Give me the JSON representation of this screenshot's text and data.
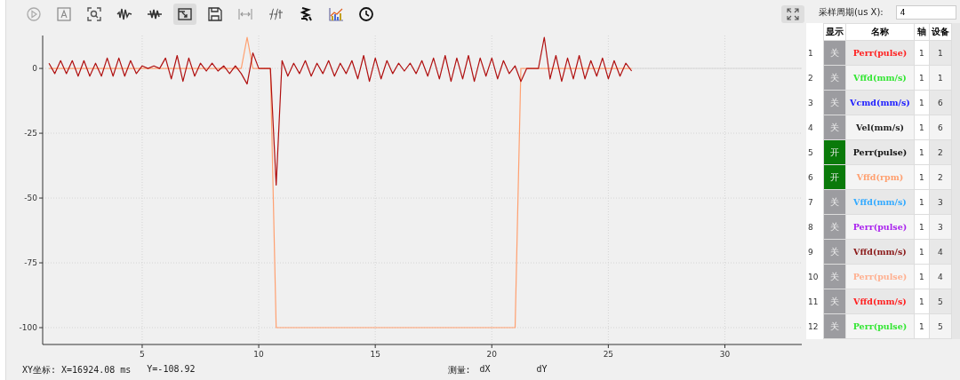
{
  "toolbar": [
    {
      "kind": "play",
      "selected": false
    },
    {
      "kind": "text",
      "selected": false
    },
    {
      "kind": "zoom",
      "selected": false
    },
    {
      "kind": "wave",
      "selected": false
    },
    {
      "kind": "filter",
      "selected": false
    },
    {
      "kind": "export",
      "selected": true
    },
    {
      "kind": "save",
      "selected": false
    },
    {
      "kind": "span",
      "selected": false
    },
    {
      "kind": "fft",
      "selected": false
    },
    {
      "kind": "stairs",
      "selected": false
    },
    {
      "kind": "chart",
      "selected": false
    },
    {
      "kind": "clock",
      "selected": false
    }
  ],
  "chart": {
    "chart_data": {
      "type": "line",
      "grid": true,
      "xlim": [
        0.73,
        33.3
      ],
      "ylim": [
        -106.5,
        12.7
      ],
      "xticks": [
        5,
        10,
        15,
        20,
        25,
        30
      ],
      "yticks": [
        0,
        -25,
        -50,
        -75,
        -100
      ],
      "x": [
        1,
        1.25,
        1.5,
        1.75,
        2,
        2.25,
        2.5,
        2.75,
        3,
        3.25,
        3.5,
        3.75,
        4,
        4.25,
        4.5,
        4.75,
        5,
        5.25,
        5.5,
        5.75,
        6,
        6.25,
        6.5,
        6.75,
        7,
        7.25,
        7.5,
        7.75,
        8,
        8.25,
        8.5,
        8.75,
        9,
        9.25,
        9.5,
        9.75,
        10,
        10.25,
        10.5,
        10.75,
        11,
        11.25,
        11.5,
        11.75,
        12,
        12.25,
        12.5,
        12.75,
        13,
        13.25,
        13.5,
        13.75,
        14,
        14.25,
        14.5,
        14.75,
        15,
        15.25,
        15.5,
        15.75,
        16,
        16.25,
        16.5,
        16.75,
        17,
        17.25,
        17.5,
        17.75,
        18,
        18.25,
        18.5,
        18.75,
        19,
        19.25,
        19.5,
        19.75,
        20,
        20.25,
        20.5,
        20.75,
        21,
        21.25,
        21.5,
        21.75,
        22,
        22.25,
        22.5,
        22.75,
        23,
        23.25,
        23.5,
        23.75,
        24,
        24.25,
        24.5,
        24.75,
        25,
        25.25,
        25.5,
        25.75,
        26
      ],
      "series": [
        {
          "color": "#ffa070",
          "values": [
            0,
            0,
            0,
            0,
            0,
            0,
            0,
            0,
            0,
            0,
            0,
            0,
            0,
            0,
            0,
            0,
            0,
            0,
            0,
            0,
            0,
            0,
            0,
            0,
            0,
            0,
            0,
            0,
            0,
            0,
            0,
            0,
            0,
            0,
            12,
            0,
            0,
            0,
            0,
            -100,
            -100,
            -100,
            -100,
            -100,
            -100,
            -100,
            -100,
            -100,
            -100,
            -100,
            -100,
            -100,
            -100,
            -100,
            -100,
            -100,
            -100,
            -100,
            -100,
            -100,
            -100,
            -100,
            -100,
            -100,
            -100,
            -100,
            -100,
            -100,
            -100,
            -100,
            -100,
            -100,
            -100,
            -100,
            -100,
            -100,
            -100,
            -100,
            -100,
            -100,
            -100,
            0,
            0,
            0,
            0,
            0,
            0,
            0,
            0,
            0,
            0,
            0,
            0,
            0,
            0,
            0,
            0,
            0,
            0,
            0,
            0
          ]
        },
        {
          "color": "#b01010",
          "values": [
            2,
            -2,
            3,
            -2,
            3,
            -3,
            3,
            -3,
            2,
            -3,
            4,
            -3,
            4,
            -3,
            3,
            -2,
            1,
            0,
            1,
            0,
            4,
            -4,
            5,
            -5,
            4,
            -3,
            2,
            -1,
            2,
            -1,
            1,
            -2,
            1,
            -2,
            -6,
            6,
            0,
            0,
            0,
            -45,
            3,
            -3,
            2,
            -2,
            3,
            -3,
            2,
            -2,
            3,
            -3,
            2,
            -2,
            3,
            -4,
            5,
            -5,
            4,
            -4,
            3,
            -2,
            2,
            -1,
            2,
            -2,
            3,
            -3,
            4,
            -4,
            5,
            -5,
            4,
            -4,
            5,
            -5,
            4,
            -3,
            4,
            -4,
            3,
            -2,
            1,
            -5,
            0,
            0,
            0,
            12,
            -4,
            5,
            -5,
            4,
            -4,
            5,
            -4,
            3,
            -3,
            4,
            -4,
            3,
            -3,
            2,
            -1
          ]
        }
      ]
    }
  },
  "status": {
    "coords": "XY坐标: X=16924.08 ms",
    "y": "Y=-108.92",
    "measure": "测量:",
    "dx": "dX",
    "dy": "dY"
  },
  "panel": {
    "period_label": "采样周期(us X):",
    "period_value": "4",
    "columns": [
      "显示",
      "名称",
      "轴",
      "设备"
    ],
    "rows": [
      {
        "index": "1",
        "display": "关",
        "on": false,
        "name": "Perr(pulse)",
        "color": "#ff2020",
        "axis": "1",
        "device": "1"
      },
      {
        "index": "2",
        "display": "关",
        "on": false,
        "name": "Vffd(mm/s)",
        "color": "#33e633",
        "axis": "1",
        "device": "1"
      },
      {
        "index": "3",
        "display": "关",
        "on": false,
        "name": "Vcmd(mm/s)",
        "color": "#2020ff",
        "axis": "1",
        "device": "6"
      },
      {
        "index": "4",
        "display": "关",
        "on": false,
        "name": "Vel(mm/s)",
        "color": "#222222",
        "axis": "1",
        "device": "6"
      },
      {
        "index": "5",
        "display": "开",
        "on": true,
        "name": "Perr(pulse)",
        "color": "#111111",
        "axis": "1",
        "device": "2"
      },
      {
        "index": "6",
        "display": "开",
        "on": true,
        "name": "Vffd(rpm)",
        "color": "#ffa070",
        "axis": "1",
        "device": "2"
      },
      {
        "index": "7",
        "display": "关",
        "on": false,
        "name": "Vffd(mm/s)",
        "color": "#33aaff",
        "axis": "1",
        "device": "3"
      },
      {
        "index": "8",
        "display": "关",
        "on": false,
        "name": "Perr(pulse)",
        "color": "#aa22ee",
        "axis": "1",
        "device": "3"
      },
      {
        "index": "9",
        "display": "关",
        "on": false,
        "name": "Vffd(mm/s)",
        "color": "#8b1a1a",
        "axis": "1",
        "device": "4"
      },
      {
        "index": "10",
        "display": "关",
        "on": false,
        "name": "Perr(pulse)",
        "color": "#ffb090",
        "axis": "1",
        "device": "4"
      },
      {
        "index": "11",
        "display": "关",
        "on": false,
        "name": "Vffd(mm/s)",
        "color": "#ff2020",
        "axis": "1",
        "device": "5"
      },
      {
        "index": "12",
        "display": "关",
        "on": false,
        "name": "Perr(pulse)",
        "color": "#33e633",
        "axis": "1",
        "device": "5"
      }
    ]
  }
}
